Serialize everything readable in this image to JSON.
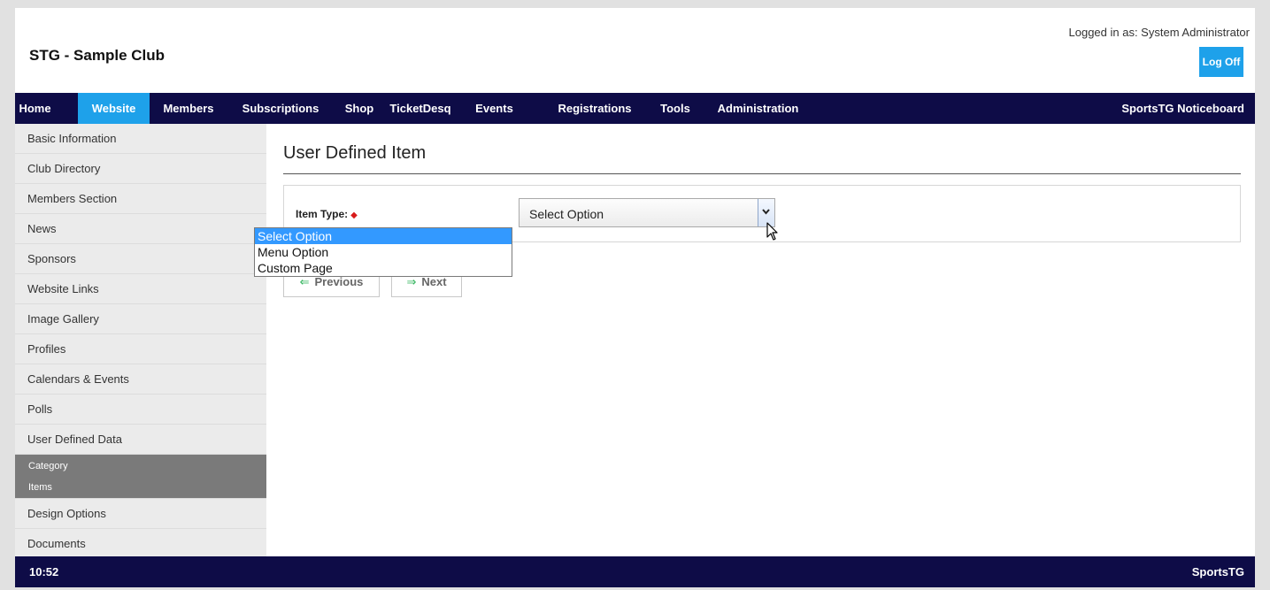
{
  "header": {
    "site_title": "STG - Sample Club",
    "logged_in": "Logged in as: System Administrator",
    "logoff_label": "Log Off"
  },
  "topnav": {
    "items": [
      {
        "label": "Home"
      },
      {
        "label": "Website",
        "active": true
      },
      {
        "label": "Members"
      },
      {
        "label": "Subscriptions"
      },
      {
        "label": "Shop"
      },
      {
        "label": "TicketDesq"
      },
      {
        "label": "Events"
      },
      {
        "label": "Registrations"
      },
      {
        "label": "Tools"
      },
      {
        "label": "Administration"
      }
    ],
    "right_label": "SportsTG Noticeboard"
  },
  "sidebar": {
    "items": [
      {
        "label": "Basic Information"
      },
      {
        "label": "Club Directory"
      },
      {
        "label": "Members Section"
      },
      {
        "label": "News"
      },
      {
        "label": "Sponsors"
      },
      {
        "label": "Website Links"
      },
      {
        "label": "Image Gallery"
      },
      {
        "label": "Profiles"
      },
      {
        "label": "Calendars & Events"
      },
      {
        "label": "Polls"
      },
      {
        "label": "User Defined Data"
      },
      {
        "label": "Design Options"
      },
      {
        "label": "Documents"
      }
    ],
    "sub_items": [
      {
        "label": "Category"
      },
      {
        "label": "Items"
      }
    ]
  },
  "main": {
    "page_title": "User Defined Item",
    "form": {
      "item_type_label": "Item Type:",
      "required_marker": "◆",
      "select_value": "Select Option",
      "options": [
        "Select Option",
        "Menu Option",
        "Custom Page"
      ],
      "selected_index": 0
    },
    "previous_label": "Previous",
    "next_label": "Next",
    "previous_arrow": "⇐",
    "next_arrow": "⇒"
  },
  "footer": {
    "time": "10:52",
    "brand": "SportsTG"
  },
  "colors": {
    "nav_bg": "#0e0c47",
    "accent": "#1ea1ea",
    "dropdown_highlight": "#3399ff",
    "submenu_bg": "#7a7a7a"
  },
  "icons": {
    "select_arrow": "chevron-down-icon",
    "next_arrow": "arrow-right-icon",
    "previous_arrow": "arrow-left-icon"
  }
}
